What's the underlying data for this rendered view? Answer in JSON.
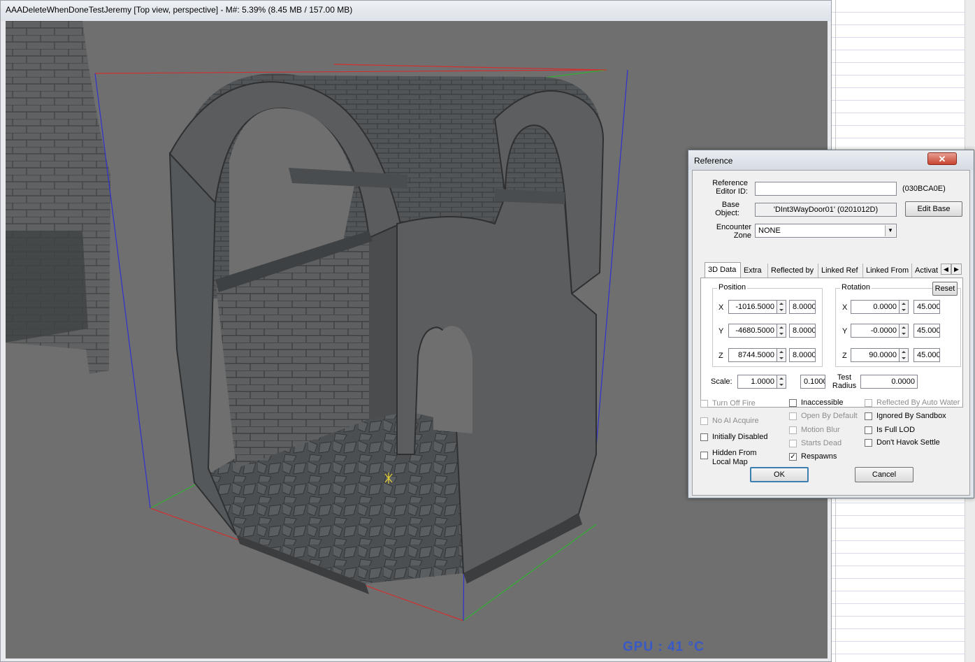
{
  "render_window": {
    "title": "AAADeleteWhenDoneTestJeremy [Top view, perspective] - M#: 5.39% (8.45 MB / 157.00 MB)",
    "gpu_overlay": "GPU : 41 °C"
  },
  "dialog": {
    "title": "Reference",
    "close_label": "✕",
    "reference_editor_id": {
      "label": "Reference Editor ID:",
      "value": "",
      "form_id": "(030BCA0E)"
    },
    "base_object": {
      "label": "Base Object:",
      "value": "'DInt3WayDoor01' (0201012D)",
      "edit_button": "Edit Base"
    },
    "encounter_zone": {
      "label": "Encounter Zone",
      "value": "NONE"
    },
    "tabs": [
      "3D Data",
      "Extra",
      "Reflected by",
      "Linked Ref",
      "Linked From",
      "Activat"
    ],
    "active_tab": "3D Data",
    "data3d": {
      "position_label": "Position",
      "rotation_label": "Rotation",
      "reset_label": "Reset",
      "axes": [
        "X",
        "Y",
        "Z"
      ],
      "position": {
        "x": "-1016.5000",
        "y": "-4680.5000",
        "z": "8744.5000",
        "step_x": "8.0000",
        "step_y": "8.0000",
        "step_z": "8.0000"
      },
      "rotation": {
        "x": "0.0000",
        "y": "-0.0000",
        "z": "90.0000",
        "step_x": "45.000",
        "step_y": "45.000",
        "step_z": "45.000"
      },
      "scale_label": "Scale:",
      "scale": "1.0000",
      "scale_step": "0.1000",
      "test_radius_label": "Test Radius",
      "test_radius": "0.0000"
    },
    "flags": {
      "col1": [
        {
          "label": "Turn Off Fire",
          "checked": false,
          "enabled": false
        },
        {
          "label": "No AI Acquire",
          "checked": false,
          "enabled": false
        },
        {
          "label": "Initially Disabled",
          "checked": false,
          "enabled": true
        },
        {
          "label": "Hidden From Local Map",
          "checked": false,
          "enabled": true
        }
      ],
      "col2": [
        {
          "label": "Inaccessible",
          "checked": false,
          "enabled": true
        },
        {
          "label": "Open By Default",
          "checked": false,
          "enabled": false
        },
        {
          "label": "Motion Blur",
          "checked": false,
          "enabled": false
        },
        {
          "label": "Starts Dead",
          "checked": false,
          "enabled": false
        },
        {
          "label": "Respawns",
          "checked": true,
          "enabled": true
        }
      ],
      "col3": [
        {
          "label": "Reflected By Auto Water",
          "checked": false,
          "enabled": false
        },
        {
          "label": "Ignored By Sandbox",
          "checked": false,
          "enabled": true
        },
        {
          "label": "Is Full LOD",
          "checked": false,
          "enabled": true
        },
        {
          "label": "Don't Havok Settle",
          "checked": false,
          "enabled": true
        }
      ]
    },
    "ok_label": "OK",
    "cancel_label": "Cancel"
  },
  "colors": {
    "gpu_text": "#2f56d6",
    "viewport_bg": "#6f6f6f",
    "bbox_red": "#d03030",
    "bbox_green": "#30b030",
    "bbox_blue": "#3030d0"
  }
}
